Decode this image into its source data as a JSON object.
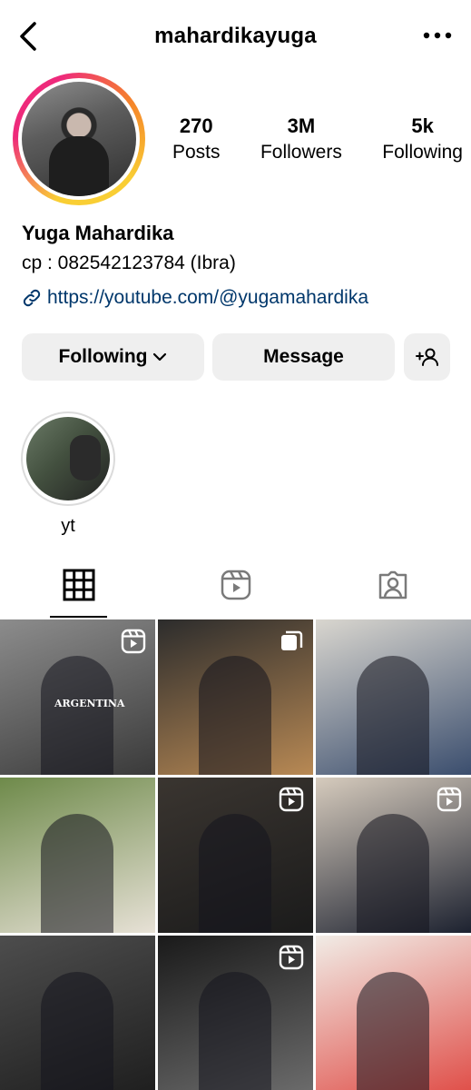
{
  "header": {
    "username": "mahardikayuga"
  },
  "profile": {
    "stats": [
      {
        "value": "270",
        "label": "Posts"
      },
      {
        "value": "3M",
        "label": "Followers"
      },
      {
        "value": "5k",
        "label": "Following"
      }
    ],
    "name": "Yuga Mahardika",
    "bio": "cp : 082542123784 (Ibra)",
    "link": "https://youtube.com/@yugamahardika"
  },
  "actions": {
    "following_label": "Following",
    "message_label": "Message"
  },
  "highlights": [
    {
      "label": "yt"
    }
  ],
  "tabs": [
    "posts-grid",
    "reels",
    "tagged"
  ],
  "posts": [
    {
      "type": "reel",
      "colors": [
        "#8c8c8c",
        "#3a3a3a"
      ],
      "shirt_text": "ARGENTINA"
    },
    {
      "type": "carousel",
      "colors": [
        "#2c2c2c",
        "#b88954"
      ]
    },
    {
      "type": "photo",
      "colors": [
        "#d9d6cf",
        "#3b4e6e"
      ]
    },
    {
      "type": "photo",
      "colors": [
        "#6e8a4a",
        "#e7e1d6"
      ]
    },
    {
      "type": "reel",
      "colors": [
        "#3a3530",
        "#1b1b1b"
      ]
    },
    {
      "type": "reel",
      "colors": [
        "#d6cbbd",
        "#1d2230"
      ]
    },
    {
      "type": "photo",
      "colors": [
        "#4d4d4d",
        "#1f1f1f"
      ]
    },
    {
      "type": "reel",
      "colors": [
        "#1a1a1a",
        "#6b6b6b"
      ]
    },
    {
      "type": "photo",
      "colors": [
        "#f1ece6",
        "#e0504a"
      ]
    }
  ]
}
